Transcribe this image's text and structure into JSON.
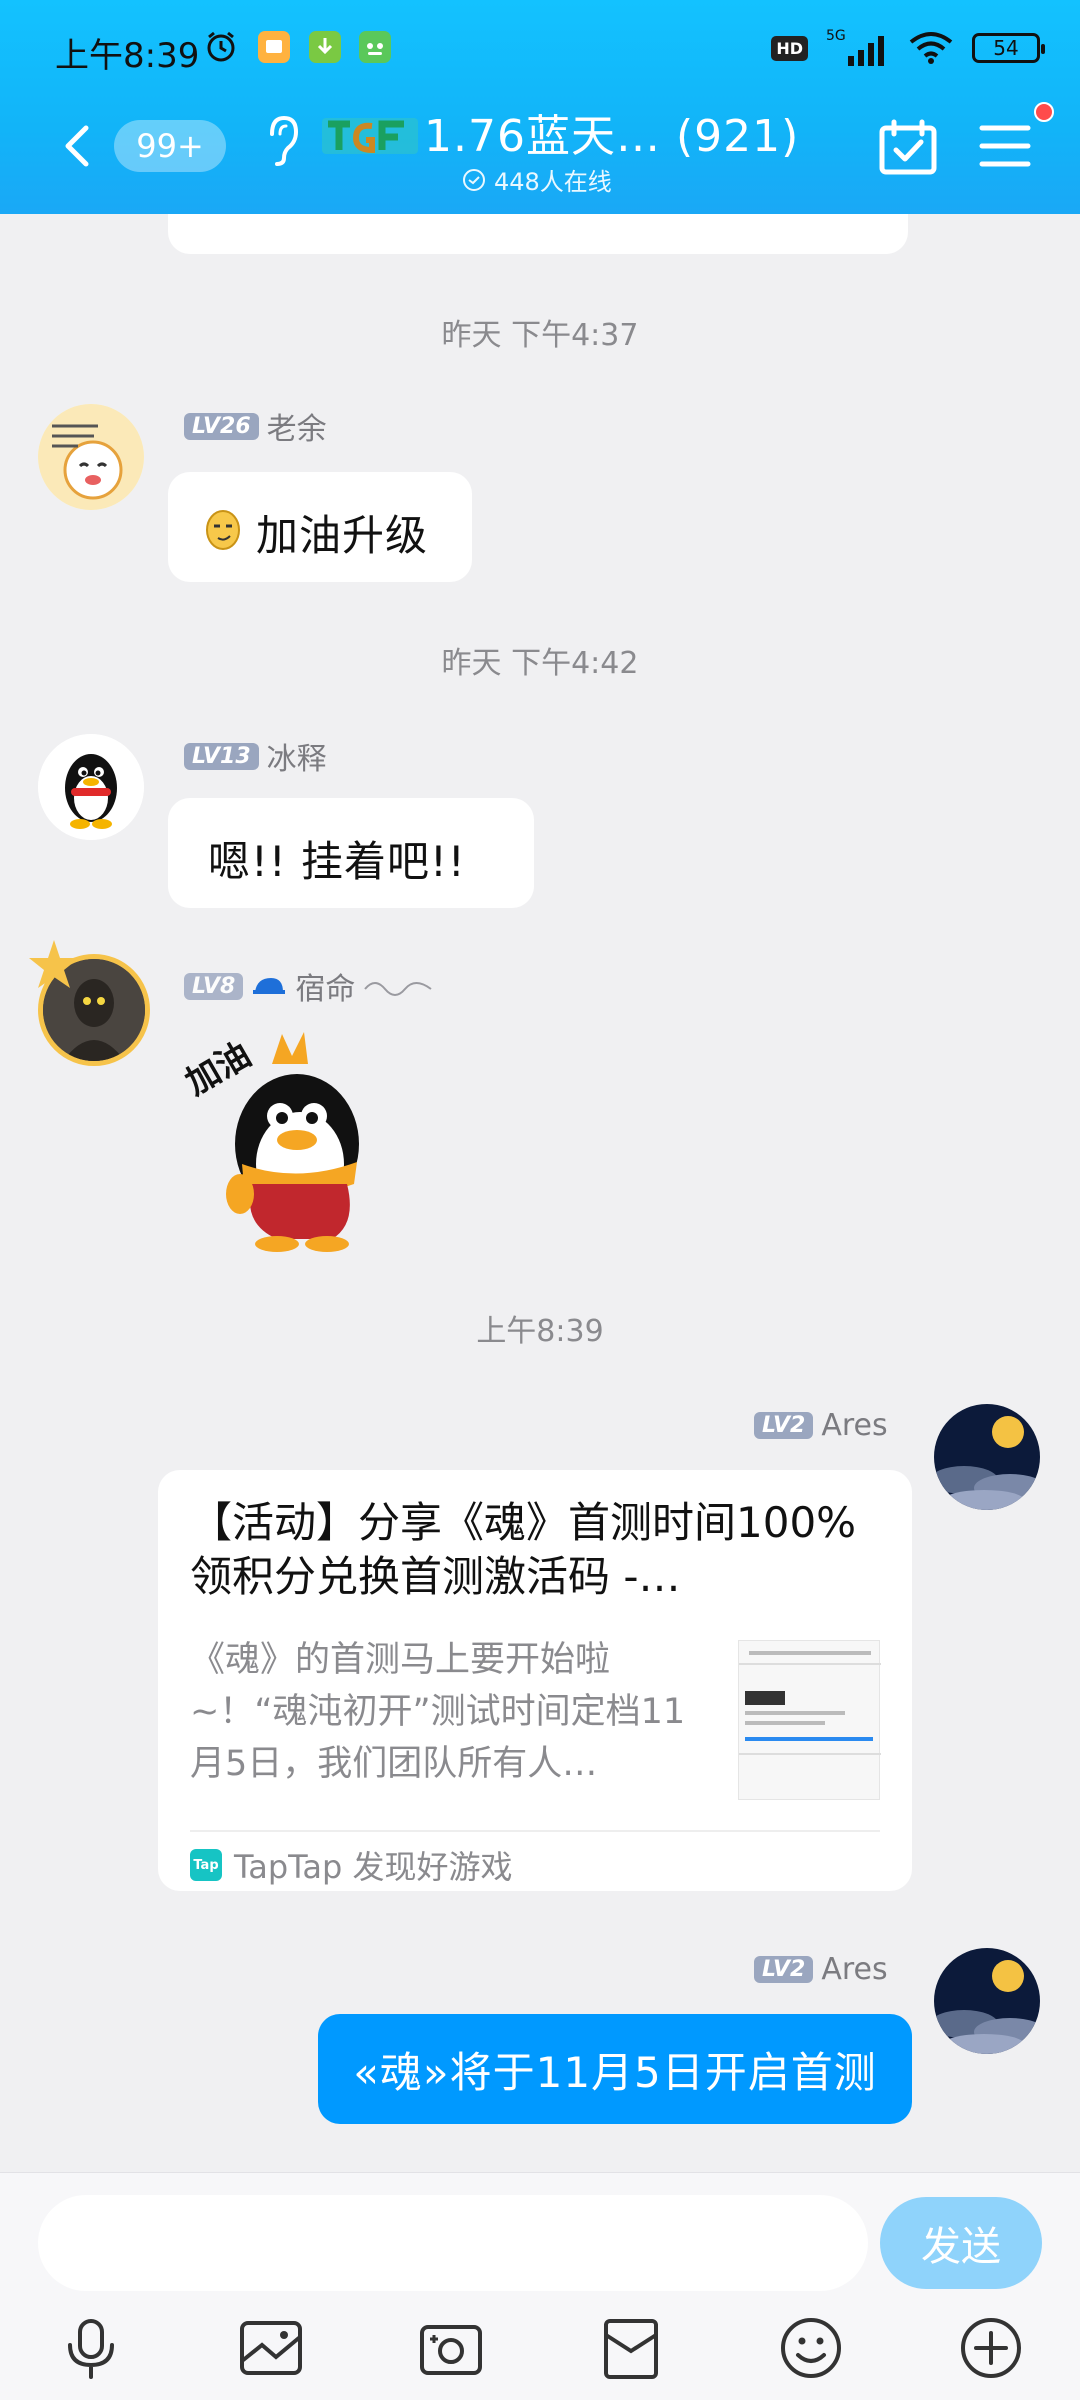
{
  "status_bar": {
    "time": "上午8:39",
    "network": "5G",
    "hd": "HD",
    "battery": "54"
  },
  "header": {
    "unread_badge": "99+",
    "group_title": "1.76蓝天… (921)",
    "online_count": "448人在线",
    "accent_color": "#12b4f8"
  },
  "messages": {
    "ts1": "昨天 下午4:37",
    "m1": {
      "level": "LV26",
      "name": "老余",
      "text": "加油升级"
    },
    "ts2": "昨天 下午4:42",
    "m2": {
      "level": "LV13",
      "name": "冰释",
      "text": "嗯!! 挂着吧!!"
    },
    "m3": {
      "level": "LV8",
      "name": "宿命"
    },
    "ts3": "上午8:39",
    "m4": {
      "level": "LV2",
      "name": "Ares",
      "card_title": "【活动】分享《魂》首测时间100%领积分兑换首测激活码 -…",
      "card_desc": "《魂》的首测马上要开始啦~！“魂沌初开”测试时间定档11月5日，我们团队所有人…",
      "card_source": "TapTap 发现好游戏",
      "tap_logo": "Tap"
    },
    "m5": {
      "level": "LV2",
      "name": "Ares",
      "text": "«魂»将于11月5日开启首测"
    }
  },
  "input": {
    "placeholder": "",
    "send_label": "发送"
  },
  "toolbar_icons": [
    "microphone-icon",
    "image-icon",
    "camera-icon",
    "red-packet-icon",
    "emoji-icon",
    "plus-icon"
  ]
}
